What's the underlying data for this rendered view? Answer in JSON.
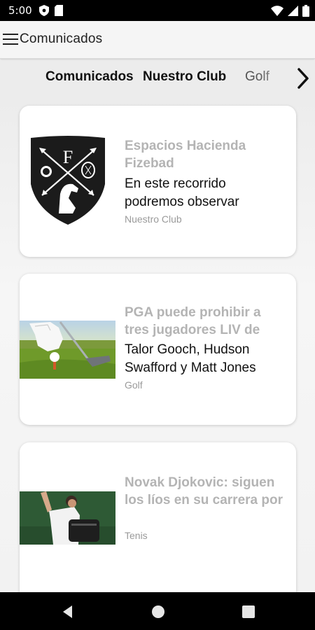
{
  "status_bar": {
    "time": "5:00",
    "icons": [
      "shield-icon",
      "sim-card-icon",
      "wifi-icon",
      "signal-icon",
      "battery-icon"
    ]
  },
  "app_bar": {
    "title": "Comunicados",
    "menu_icon": "hamburger-menu-icon"
  },
  "tabs": [
    {
      "label": "Comunicados",
      "active": true
    },
    {
      "label": "Nuestro Club",
      "active": false
    },
    {
      "label": "Golf",
      "active": false
    }
  ],
  "tabs_next_icon": "chevron-right-icon",
  "cards": [
    {
      "title": "Espacios Hacienda Fizebad",
      "excerpt": "En este recorrido podremos observar",
      "category": "Nuestro Club",
      "thumbnail": "club-crest-logo",
      "crest_letter": "F"
    },
    {
      "title": "PGA puede prohibir a tres jugadores LIV de",
      "excerpt": "Talor Gooch, Hudson Swafford y Matt Jones",
      "category": "Golf",
      "thumbnail": "golf-photo"
    },
    {
      "title": "Novak Djokovic: siguen los líos en su carrera por",
      "excerpt": "",
      "category": "Tenis",
      "thumbnail": "tennis-player-photo"
    }
  ],
  "nav_bar": {
    "back_icon": "back-triangle-icon",
    "home_icon": "home-circle-icon",
    "recents_icon": "recents-square-icon"
  },
  "colors": {
    "title_gray": "#b4b4b4",
    "text_dark": "#111111",
    "category_gray": "#9a9a9a",
    "crest_dark": "#1b1b1b"
  }
}
